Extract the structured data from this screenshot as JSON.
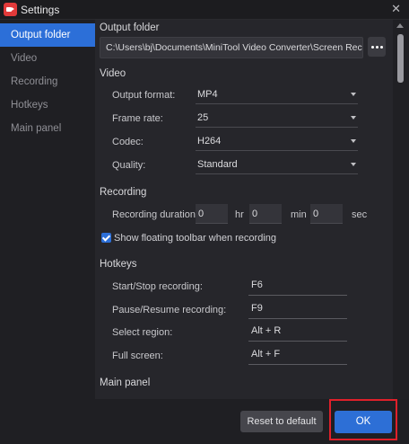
{
  "window": {
    "title": "Settings",
    "close_glyph": "✕"
  },
  "sidebar": {
    "items": [
      {
        "label": "Output folder"
      },
      {
        "label": "Video"
      },
      {
        "label": "Recording"
      },
      {
        "label": "Hotkeys"
      },
      {
        "label": "Main panel"
      }
    ]
  },
  "output_folder": {
    "heading": "Output folder",
    "path": "C:\\Users\\bj\\Documents\\MiniTool Video Converter\\Screen Reco"
  },
  "video": {
    "heading": "Video",
    "output_format_label": "Output format:",
    "output_format_value": "MP4",
    "frame_rate_label": "Frame rate:",
    "frame_rate_value": "25",
    "codec_label": "Codec:",
    "codec_value": "H264",
    "quality_label": "Quality:",
    "quality_value": "Standard"
  },
  "recording": {
    "heading": "Recording",
    "duration_label": "Recording duration",
    "hr_value": "0",
    "hr_unit": "hr",
    "min_value": "0",
    "min_unit": "min",
    "sec_value": "0",
    "sec_unit": "sec",
    "floating_toolbar_label": "Show floating toolbar when recording",
    "floating_toolbar_checked": true
  },
  "hotkeys": {
    "heading": "Hotkeys",
    "start_stop_label": "Start/Stop recording:",
    "start_stop_value": "F6",
    "pause_resume_label": "Pause/Resume recording:",
    "pause_resume_value": "F9",
    "select_region_label": "Select region:",
    "select_region_value": "Alt + R",
    "full_screen_label": "Full screen:",
    "full_screen_value": "Alt + F"
  },
  "main_panel": {
    "heading": "Main panel"
  },
  "footer": {
    "reset_label": "Reset to default",
    "ok_label": "OK"
  },
  "colors": {
    "accent": "#2c6fd8",
    "highlight": "#e0202a",
    "background": "#26262b"
  }
}
